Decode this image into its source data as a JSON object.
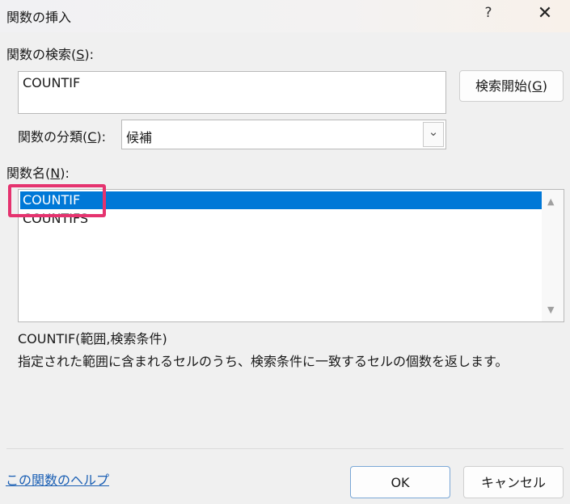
{
  "titlebar": {
    "title": "関数の挿入",
    "help": "?",
    "close": "✕"
  },
  "search": {
    "label": "関数の検索(",
    "label_key": "S",
    "label_end": "):",
    "value": "COUNTIF",
    "go_label": "検索開始(",
    "go_key": "G",
    "go_end": ")"
  },
  "category": {
    "label": "関数の分類(",
    "label_key": "C",
    "label_end": "):",
    "value": "候補",
    "chevron": "⌄"
  },
  "functions": {
    "label": "関数名(",
    "label_key": "N",
    "label_end": "):",
    "items": [
      "COUNTIF",
      "COUNTIFS"
    ],
    "selected_index": 0,
    "scroll_up": "▲",
    "scroll_down": "▼"
  },
  "details": {
    "syntax": "COUNTIF(範囲,検索条件)",
    "description": "指定された範囲に含まれるセルのうち、検索条件に一致するセルの個数を返します。"
  },
  "footer": {
    "help_link": "この関数のヘルプ",
    "ok": "OK",
    "cancel": "キャンセル"
  },
  "colors": {
    "selection": "#0078d7",
    "highlight": "#e5336f",
    "link": "#1a5fb4"
  }
}
